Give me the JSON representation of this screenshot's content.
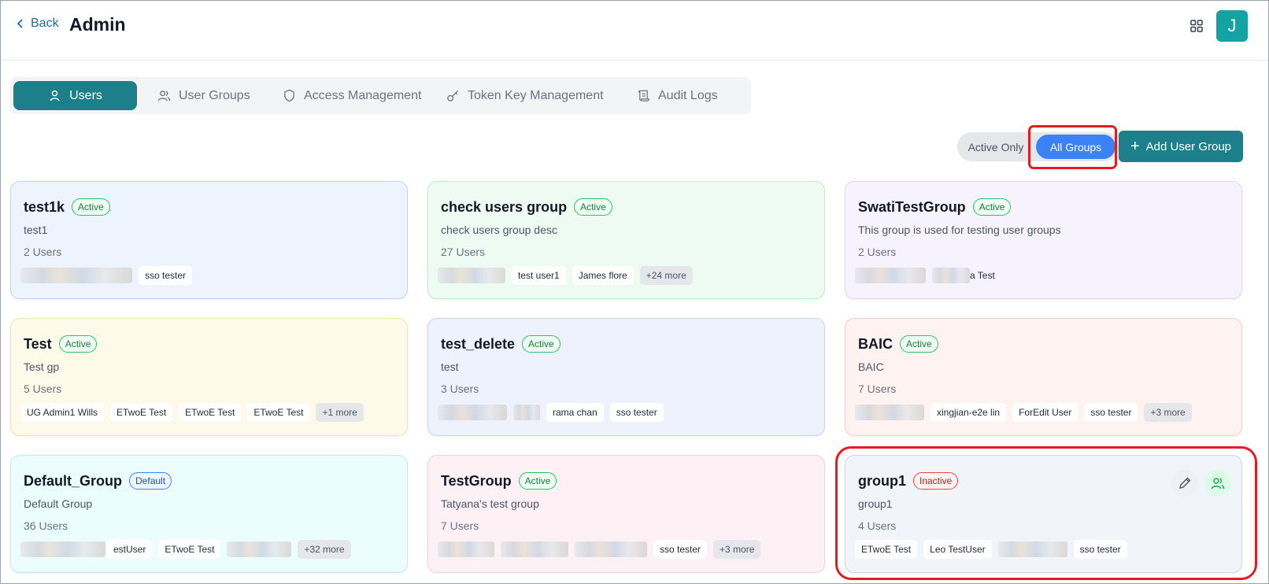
{
  "header": {
    "back_label": "Back",
    "title": "Admin",
    "avatar_initial": "J"
  },
  "tabs": [
    {
      "label": "Users",
      "active": true,
      "icon": "user-icon"
    },
    {
      "label": "User Groups",
      "active": false,
      "icon": "users-icon"
    },
    {
      "label": "Access Management",
      "active": false,
      "icon": "shield-icon"
    },
    {
      "label": "Token Key Management",
      "active": false,
      "icon": "key-icon"
    },
    {
      "label": "Audit Logs",
      "active": false,
      "icon": "scroll-icon"
    }
  ],
  "filter": {
    "active_only": "Active Only",
    "all_groups": "All Groups",
    "selected": "All Groups"
  },
  "add_button": {
    "label": "Add User Group"
  },
  "groups": [
    {
      "name": "test1k",
      "status": "Active",
      "description": "test1",
      "user_count": "2 Users",
      "members": [
        "sso tester"
      ]
    },
    {
      "name": "check users group",
      "status": "Active",
      "description": "check users group desc",
      "user_count": "27 Users",
      "members": [
        "test user1",
        "James flore"
      ],
      "more": "+24 more"
    },
    {
      "name": "SwatiTestGroup",
      "status": "Active",
      "description": "This group is used for testing user groups",
      "user_count": "2 Users",
      "members": [
        "a Test"
      ]
    },
    {
      "name": "Test",
      "status": "Active",
      "description": "Test gp",
      "user_count": "5 Users",
      "members": [
        "UG Admin1 Wills",
        "ETwoE Test",
        "ETwoE Test",
        "ETwoE Test"
      ],
      "more": "+1 more"
    },
    {
      "name": "test_delete",
      "status": "Active",
      "description": "test",
      "user_count": "3 Users",
      "members": [
        "rama chan",
        "sso tester"
      ]
    },
    {
      "name": "BAIC",
      "status": "Active",
      "description": "BAIC",
      "user_count": "7 Users",
      "members": [
        "xingjian-e2e lin",
        "ForEdit User",
        "sso tester"
      ],
      "more": "+3 more"
    },
    {
      "name": "Default_Group",
      "status": "Default",
      "description": "Default Group",
      "user_count": "36 Users",
      "members": [
        "estUser",
        "ETwoE Test"
      ],
      "more": "+32 more"
    },
    {
      "name": "TestGroup",
      "status": "Active",
      "description": "Tatyana's test group",
      "user_count": "7 Users",
      "members": [
        "sso tester"
      ],
      "more": "+3 more"
    },
    {
      "name": "group1",
      "status": "Inactive",
      "description": "group1",
      "user_count": "4 Users",
      "members": [
        "ETwoE Test",
        "Leo TestUser",
        "sso tester"
      ]
    }
  ],
  "colors": {
    "primary": "#1d7f8a",
    "toggle_on": "#3b82f6",
    "highlight": "#e11d24"
  }
}
